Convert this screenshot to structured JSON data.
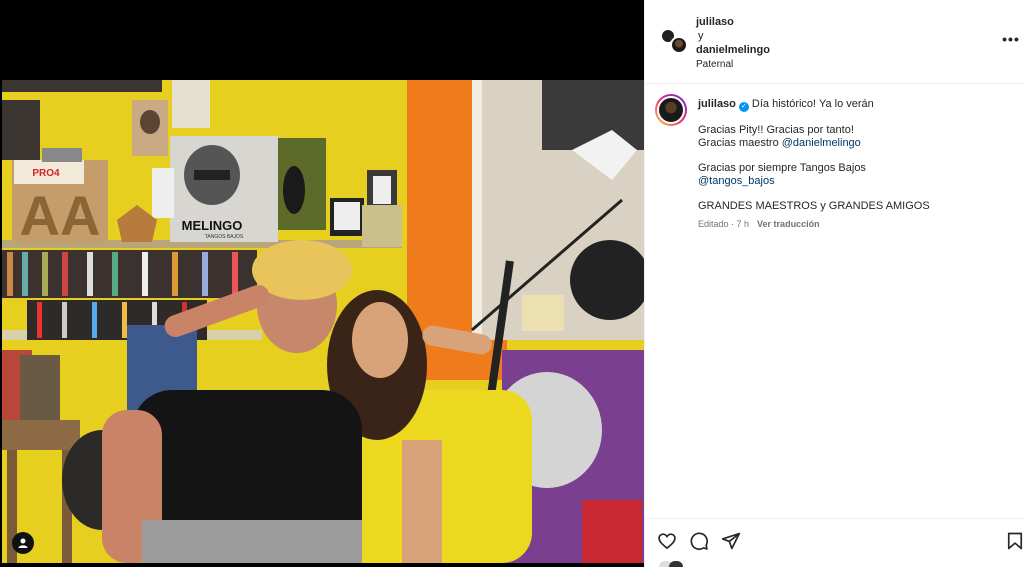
{
  "post": {
    "header": {
      "user1": "julilaso",
      "joiner": "y",
      "user2": "danielmelingo",
      "location": "Paternal",
      "more_icon": "more-horizontal-icon"
    },
    "caption": {
      "username": "julilaso",
      "verified_icon": "verified-badge-icon",
      "line1": "Día histórico! Ya lo verán",
      "line2": "Gracias Pity!! Gracias por tanto!",
      "line3_prefix": "Gracias maestro ",
      "line3_mention": "@danielmelingo",
      "line4": "Gracias por siempre Tangos Bajos",
      "line5_mention": "@tangos_bajos",
      "line6": "GRANDES MAESTROS y GRANDES AMIGOS",
      "edited": "Editado · 7 h",
      "translate": "Ver traducción"
    },
    "photo": {
      "album_title": "MELINGO",
      "album_subtitle": "TANGOS BAJOS",
      "sign_text": "PRO4"
    },
    "actions": {
      "like_icon": "heart-icon",
      "comment_icon": "comment-icon",
      "share_icon": "send-icon",
      "save_icon": "bookmark-icon"
    },
    "colors": {
      "wall_yellow": "#e6cf1e",
      "accent_blue": "#0095f6",
      "mention_blue": "#00376b"
    }
  }
}
